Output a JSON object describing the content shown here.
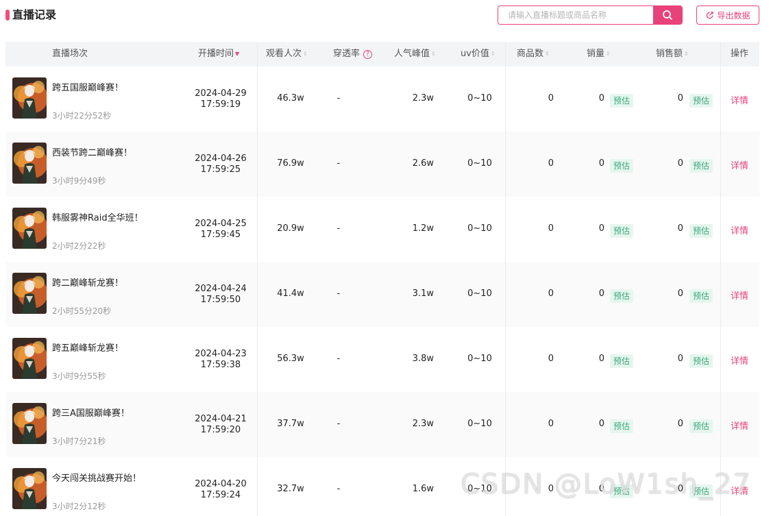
{
  "header": {
    "title": "直播记录",
    "search_placeholder": "请输入直播标题或商品名称",
    "export_label": "导出数据"
  },
  "columns": {
    "session": "直播场次",
    "start_time": "开播时间",
    "viewers": "观看人次",
    "penetration": "穿透率",
    "peak": "人气峰值",
    "uv": "uv价值",
    "products": "商品数",
    "sales": "销量",
    "revenue": "销售额",
    "action": "操作"
  },
  "badges": {
    "estimate": "预估",
    "detail": "详情"
  },
  "rows": [
    {
      "title": "跨五国服巅峰赛！",
      "duration": "3小时22分52秒",
      "date": "2024-04-29",
      "time": "17:59:19",
      "viewers": "46.3w",
      "penetration": "-",
      "peak": "2.3w",
      "uv": "0~10",
      "products": "0",
      "sales": "0",
      "revenue": "0"
    },
    {
      "title": "西装节跨二巅峰赛！",
      "duration": "3小时9分49秒",
      "date": "2024-04-26",
      "time": "17:59:25",
      "viewers": "76.9w",
      "penetration": "-",
      "peak": "2.6w",
      "uv": "0~10",
      "products": "0",
      "sales": "0",
      "revenue": "0"
    },
    {
      "title": "韩服雾神Raid全华班！",
      "duration": "2小时2分22秒",
      "date": "2024-04-25",
      "time": "17:59:45",
      "viewers": "20.9w",
      "penetration": "-",
      "peak": "1.2w",
      "uv": "0~10",
      "products": "0",
      "sales": "0",
      "revenue": "0"
    },
    {
      "title": "跨二巅峰斩龙赛！",
      "duration": "2小时55分20秒",
      "date": "2024-04-24",
      "time": "17:59:50",
      "viewers": "41.4w",
      "penetration": "-",
      "peak": "3.1w",
      "uv": "0~10",
      "products": "0",
      "sales": "0",
      "revenue": "0"
    },
    {
      "title": "跨五巅峰斩龙赛！",
      "duration": "3小时9分55秒",
      "date": "2024-04-23",
      "time": "17:59:38",
      "viewers": "56.3w",
      "penetration": "-",
      "peak": "3.8w",
      "uv": "0~10",
      "products": "0",
      "sales": "0",
      "revenue": "0"
    },
    {
      "title": "跨三A国服巅峰赛！",
      "duration": "3小时7分21秒",
      "date": "2024-04-21",
      "time": "17:59:20",
      "viewers": "37.7w",
      "penetration": "-",
      "peak": "2.3w",
      "uv": "0~10",
      "products": "0",
      "sales": "0",
      "revenue": "0"
    },
    {
      "title": "今天闯关挑战赛开始！",
      "duration": "3小时2分12秒",
      "date": "2024-04-20",
      "time": "17:59:24",
      "viewers": "32.7w",
      "penetration": "-",
      "peak": "1.6w",
      "uv": "0~10",
      "products": "0",
      "sales": "0",
      "revenue": "0"
    }
  ],
  "watermark": "CSDN @LoW1sh_27",
  "colors": {
    "accent": "#e9417a",
    "estimate_text": "#3aa87d",
    "estimate_bg": "#e6f6ef"
  }
}
